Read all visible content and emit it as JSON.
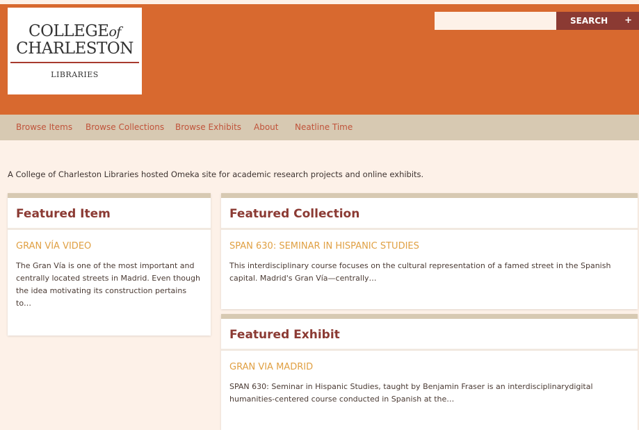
{
  "logo": {
    "line1_main": "COLLEGE",
    "line1_of": "of",
    "line2": "CHARLESTON",
    "subtitle": "LIBRARIES"
  },
  "search": {
    "placeholder": "",
    "button_label": "SEARCH",
    "plus": "+"
  },
  "nav": {
    "items": [
      {
        "label": "Browse Items"
      },
      {
        "label": "Browse Collections"
      },
      {
        "label": "Browse Exhibits"
      },
      {
        "label": "About"
      },
      {
        "label": "Neatline Time"
      }
    ]
  },
  "tagline": "A College of Charleston Libraries hosted Omeka site for academic research projects and online exhibits.",
  "featured_item": {
    "heading": "Featured Item",
    "title": "GRAN VÍA VIDEO",
    "description": "The Gran Vía is one of the most important and centrally located streets in Madrid. Even though the idea motivating its construction pertains to…"
  },
  "featured_collection": {
    "heading": "Featured Collection",
    "title": "SPAN 630: SEMINAR IN HISPANIC STUDIES",
    "description": "This interdisciplinary course focuses on the cultural representation of a famed street in the Spanish capital. Madrid's Gran Vía—centrally…"
  },
  "featured_exhibit": {
    "heading": "Featured Exhibit",
    "title": "GRAN VIA MADRID",
    "description": "SPAN 630: Seminar in Hispanic Studies, taught by Benjamin Fraser is an interdisciplinarydigital humanities-centered course conducted in Spanish at the…"
  },
  "colors": {
    "header_bg": "#d8692f",
    "nav_bg": "#d7c9b2",
    "page_bg": "#fdf1e8",
    "heading": "#8b3a33",
    "link": "#e0a043",
    "nav_link": "#c0533a",
    "search_button": "#8b3a33"
  }
}
